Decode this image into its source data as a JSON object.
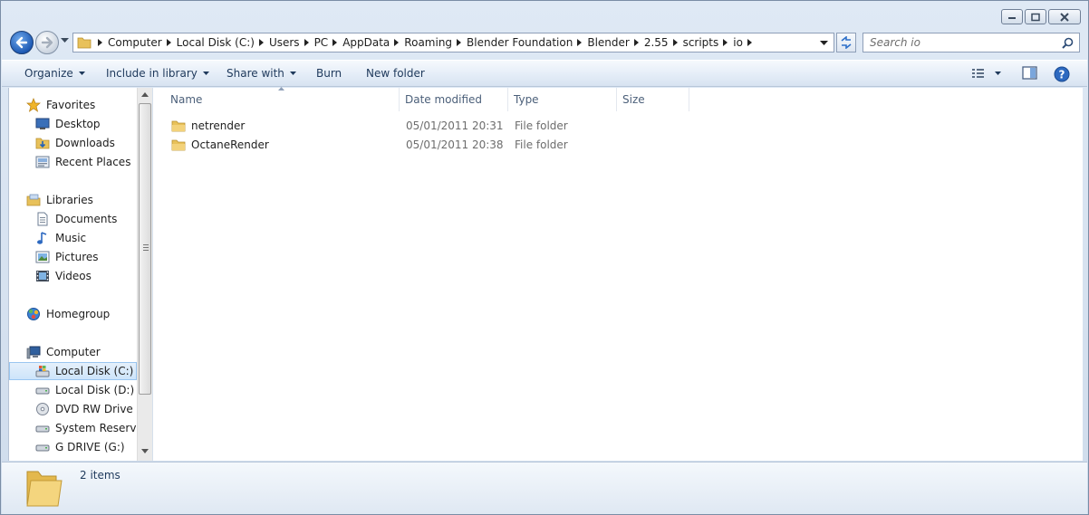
{
  "address": {
    "crumbs": [
      "Computer",
      "Local Disk (C:)",
      "Users",
      "PC",
      "AppData",
      "Roaming",
      "Blender Foundation",
      "Blender",
      "2.55",
      "scripts",
      "io"
    ]
  },
  "search": {
    "placeholder": "Search io"
  },
  "toolbar": {
    "organize": "Organize",
    "include_in_library": "Include in library",
    "share_with": "Share with",
    "burn": "Burn",
    "new_folder": "New folder"
  },
  "nav": {
    "favorites": "Favorites",
    "desktop": "Desktop",
    "downloads": "Downloads",
    "recent_places": "Recent Places",
    "libraries": "Libraries",
    "documents": "Documents",
    "music": "Music",
    "pictures": "Pictures",
    "videos": "Videos",
    "homegroup": "Homegroup",
    "computer": "Computer",
    "local_disk_c": "Local Disk (C:)",
    "local_disk_d": "Local Disk (D:)",
    "dvd_drive": "DVD RW Drive (E:",
    "system_reserved": "System Reserved",
    "g_drive": "G DRIVE (G:)"
  },
  "columns": {
    "name": "Name",
    "date_modified": "Date modified",
    "type": "Type",
    "size": "Size"
  },
  "files": [
    {
      "name": "netrender",
      "date": "05/01/2011 20:31",
      "type": "File folder"
    },
    {
      "name": "OctaneRender",
      "date": "05/01/2011 20:38",
      "type": "File folder"
    }
  ],
  "status": {
    "item_count": "2 items"
  },
  "colors": {
    "accent": "#1e5ab4",
    "folder": "#e8c15a",
    "selection": "#cde4fa"
  }
}
